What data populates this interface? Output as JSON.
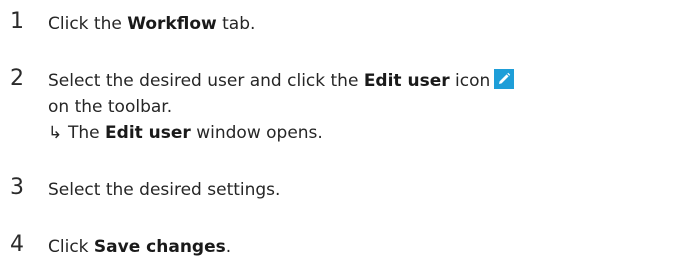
{
  "steps": [
    {
      "number": "1",
      "prefix": "Click the ",
      "bold": "Workflow",
      "suffix": " tab."
    },
    {
      "number": "2",
      "prefix": "Select the desired user and click the ",
      "bold": "Edit user",
      "suffix": " icon",
      "icon": "pencil-edit-icon",
      "line2": "on the toolbar.",
      "result_arrow": "↳",
      "result_prefix": "The ",
      "result_bold": "Edit user",
      "result_suffix": " window opens."
    },
    {
      "number": "3",
      "text": "Select the desired settings."
    },
    {
      "number": "4",
      "prefix": "Click ",
      "bold": "Save changes",
      "suffix": "."
    }
  ],
  "colors": {
    "icon_background": "#1e9ed8",
    "icon_foreground": "#ffffff",
    "text": "#262626"
  }
}
